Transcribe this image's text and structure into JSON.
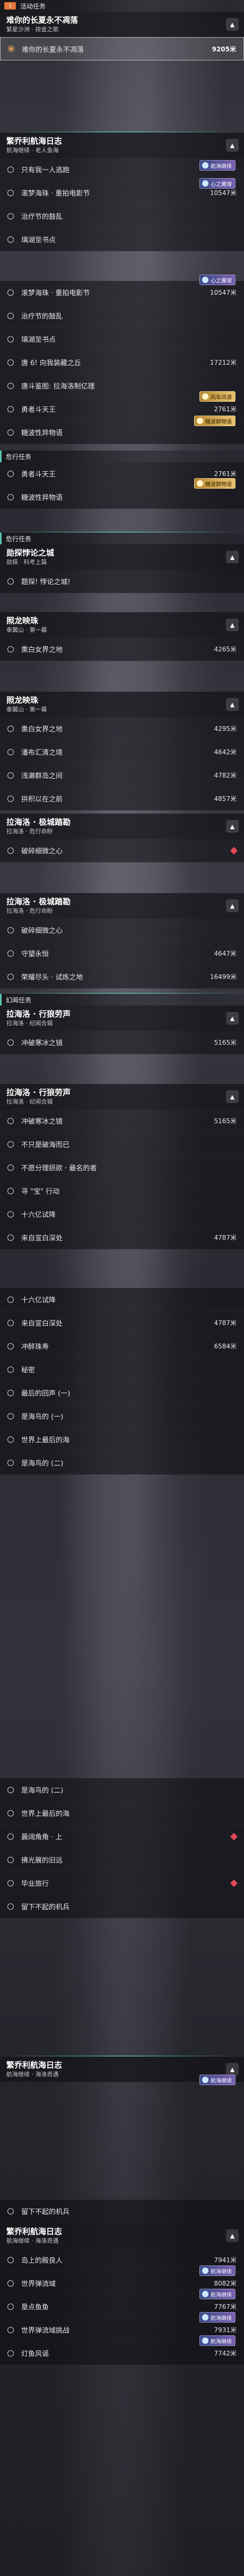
{
  "categories": {
    "activity": {
      "tag": "1",
      "label": "活动任务"
    },
    "dangerous": {
      "label": "危行任务"
    },
    "world": {
      "label": "世界任务"
    },
    "wonder": {
      "label": "幻闻任务"
    }
  },
  "quests": {
    "q1": {
      "title": "难你的长夏永不凋落",
      "subtitle": "繁星沙洲 · 掠金之歌"
    },
    "q2": {
      "title": "繁乔利航海日志",
      "subtitle": "航海继续 · 老人鱼海"
    },
    "q3": {
      "title": "繁乔利航海日志",
      "subtitle": "航海继续 · 老人鱼海"
    },
    "q4": {
      "title": "勋探悖论之城",
      "subtitle": "勋探 · 科考上篇"
    },
    "q5": {
      "title": "照龙映珠",
      "subtitle": "泰翼山 · 第一幕"
    },
    "q6": {
      "title": "照龙映珠",
      "subtitle": "泰翼山 · 第一幕"
    },
    "q7": {
      "title": "拉海洛 · 极城踏勘",
      "subtitle": "拉海洛 · 危行命盼"
    },
    "q8": {
      "title": "拉海洛 · 极城踏勘",
      "subtitle": "拉海洛 · 危行命盼"
    },
    "q9": {
      "title": "拉海洛 · 行狼劳声",
      "subtitle": "拉海洛 · 纪闻合辑"
    },
    "q10": {
      "title": "拉海洛 · 行狼劳声",
      "subtitle": "拉海洛 · 纪闻合辑"
    },
    "q11": {
      "title": "繁乔利航海日志",
      "subtitle": "航海继续 · 海洛奇遇"
    },
    "q12": {
      "title": "繁乔利航海日志",
      "subtitle": "航海继续 · 海洛奇遇"
    }
  },
  "rows": {
    "r01": {
      "label": "难你的长夏永不凋落",
      "dist": "9205米"
    },
    "r02": {
      "label": "只有我一人逃跑",
      "dist": ""
    },
    "r03": {
      "label": "滚梦海珠 · 重拍电影节",
      "dist": "10547米"
    },
    "r04": {
      "label": "治疗节的鼓乱",
      "dist": ""
    },
    "r05": {
      "label": "璃湖至书点",
      "dist": ""
    },
    "r06": {
      "label": "滚梦海珠 · 重拍电影节",
      "dist": "10547米"
    },
    "r07": {
      "label": "治疗节的鼓乱",
      "dist": ""
    },
    "r08": {
      "label": "璃湖至书点",
      "dist": ""
    },
    "r09": {
      "label": "唐 6! 向我装藏之丘",
      "dist": "17212米"
    },
    "r10": {
      "label": "唐斗鉴图: 拉海洛制亿理",
      "dist": ""
    },
    "r11": {
      "label": "勇者斗天王",
      "dist": "2761米"
    },
    "r12": {
      "label": "糖波性异物语",
      "dist": ""
    },
    "r13": {
      "label": "勇者斗天王",
      "dist": "2761米"
    },
    "r14": {
      "label": "糖波性异物语",
      "dist": ""
    },
    "r15": {
      "label": "题探! 悖论之城!",
      "dist": ""
    },
    "r16": {
      "label": "熏白女界之地",
      "dist": "4265米"
    },
    "r17": {
      "label": "熏白女界之地",
      "dist": "4295米"
    },
    "r18": {
      "label": "潘布汇清之境",
      "dist": "4642米"
    },
    "r19": {
      "label": "浅濑群岛之间",
      "dist": "4782米"
    },
    "r20": {
      "label": "拱积以在之前",
      "dist": "4857米"
    },
    "r21": {
      "label": "破碎细微之心",
      "dist": ""
    },
    "r22": {
      "label": "破碎细微之心",
      "dist": ""
    },
    "r23": {
      "label": "守望永恒",
      "dist": "4647米"
    },
    "r24": {
      "label": "荣耀尽头 · 试炼之地",
      "dist": "16499米"
    },
    "r25": {
      "label": "冲破寒冰之镜",
      "dist": "5165米"
    },
    "r26": {
      "label": "冲破寒冰之镜",
      "dist": "5165米"
    },
    "r27": {
      "label": "不只是破海而已",
      "dist": ""
    },
    "r28": {
      "label": "不愿分理损欲 · 最名的者",
      "dist": ""
    },
    "r29": {
      "label": "寻 \"宝\" 行动",
      "dist": ""
    },
    "r30": {
      "label": "十六亿试降",
      "dist": ""
    },
    "r31": {
      "label": "来自宣白深处",
      "dist": "4787米"
    },
    "r32": {
      "label": "十六亿试降",
      "dist": ""
    },
    "r33": {
      "label": "来自宣白深处",
      "dist": "4787米"
    },
    "r34": {
      "label": "冲醉珠寿",
      "dist": "6584米"
    },
    "r35": {
      "label": "秘密",
      "dist": ""
    },
    "r36": {
      "label": "最后的回声 (一)",
      "dist": ""
    },
    "r37": {
      "label": "是海鸟的 (一)",
      "dist": ""
    },
    "r38": {
      "label": "世界上最后的海",
      "dist": ""
    },
    "r39": {
      "label": "是海鸟的 (二)",
      "dist": ""
    },
    "r40": {
      "label": "是海鸟的 (二)",
      "dist": ""
    },
    "r41": {
      "label": "世界上最后的海",
      "dist": ""
    },
    "r42": {
      "label": "晨阔角角 · 上",
      "dist": ""
    },
    "r43": {
      "label": "拂光展的旧远",
      "dist": ""
    },
    "r44": {
      "label": "毕业旅行",
      "dist": ""
    },
    "r45": {
      "label": "留下不起的机兵",
      "dist": ""
    },
    "r46": {
      "label": "留下不起的机兵",
      "dist": ""
    },
    "r47": {
      "label": "岛上的殿良人",
      "dist": "7941米"
    },
    "r48": {
      "label": "世界弹流域",
      "dist": "8082米"
    },
    "r49": {
      "label": "垦点鱼鱼",
      "dist": "7767米"
    },
    "r50": {
      "label": "世界弹流域挑战",
      "dist": "7931米"
    },
    "r51": {
      "label": "灯鱼风谣",
      "dist": "7742米"
    }
  },
  "badges": {
    "voyage": "航海继续",
    "fan": "心之翼球",
    "gold1": "风车讯请",
    "gold2": "糖波群物语"
  }
}
